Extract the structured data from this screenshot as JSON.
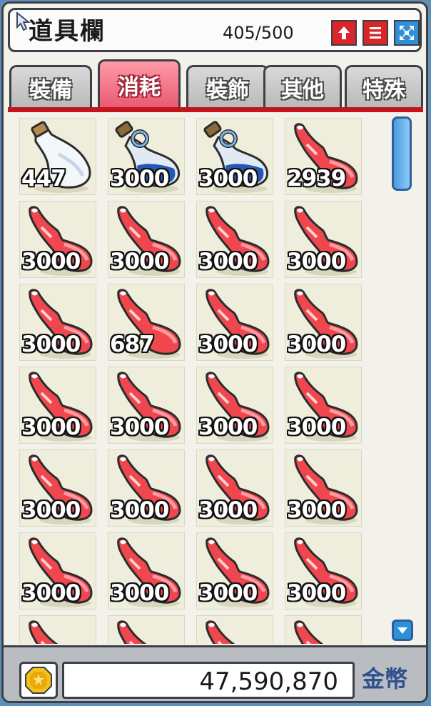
{
  "window": {
    "title": "道具欄",
    "capacity": "405/500",
    "buttons": [
      {
        "icon": "plus-icon",
        "color": "#d9262b"
      },
      {
        "icon": "menu-icon",
        "color": "#d9262b"
      },
      {
        "icon": "expand-icon",
        "color": "#2e90d6"
      }
    ]
  },
  "tabs": [
    {
      "label": "裝備",
      "active": false
    },
    {
      "label": "消耗",
      "active": true
    },
    {
      "label": "裝飾",
      "active": false
    },
    {
      "label": "其他",
      "active": false
    },
    {
      "label": "特殊",
      "active": false
    }
  ],
  "inventory": {
    "slots": [
      {
        "item": "white-potion-icon",
        "quantity": "447"
      },
      {
        "item": "blue-potion-icon",
        "quantity": "3000"
      },
      {
        "item": "blue-potion-icon",
        "quantity": "3000"
      },
      {
        "item": "red-potion-icon",
        "quantity": "2939"
      },
      {
        "item": "red-potion-icon",
        "quantity": "3000"
      },
      {
        "item": "red-potion-icon",
        "quantity": "3000"
      },
      {
        "item": "red-potion-icon",
        "quantity": "3000"
      },
      {
        "item": "red-potion-icon",
        "quantity": "3000"
      },
      {
        "item": "red-potion-icon",
        "quantity": "3000"
      },
      {
        "item": "red-potion-icon",
        "quantity": "687"
      },
      {
        "item": "red-potion-icon",
        "quantity": "3000"
      },
      {
        "item": "red-potion-icon",
        "quantity": "3000"
      },
      {
        "item": "red-potion-icon",
        "quantity": "3000"
      },
      {
        "item": "red-potion-icon",
        "quantity": "3000"
      },
      {
        "item": "red-potion-icon",
        "quantity": "3000"
      },
      {
        "item": "red-potion-icon",
        "quantity": "3000"
      },
      {
        "item": "red-potion-icon",
        "quantity": "3000"
      },
      {
        "item": "red-potion-icon",
        "quantity": "3000"
      },
      {
        "item": "red-potion-icon",
        "quantity": "3000"
      },
      {
        "item": "red-potion-icon",
        "quantity": "3000"
      },
      {
        "item": "red-potion-icon",
        "quantity": "3000"
      },
      {
        "item": "red-potion-icon",
        "quantity": "3000"
      },
      {
        "item": "red-potion-icon",
        "quantity": "3000"
      },
      {
        "item": "red-potion-icon",
        "quantity": "3000"
      },
      {
        "item": "red-potion-icon",
        "quantity": ""
      },
      {
        "item": "red-potion-icon",
        "quantity": ""
      },
      {
        "item": "red-potion-icon",
        "quantity": ""
      },
      {
        "item": "red-potion-icon",
        "quantity": ""
      }
    ]
  },
  "footer": {
    "currency_icon": "gold-coin-icon",
    "amount": "47,590,870",
    "currency_label": "金幣"
  }
}
